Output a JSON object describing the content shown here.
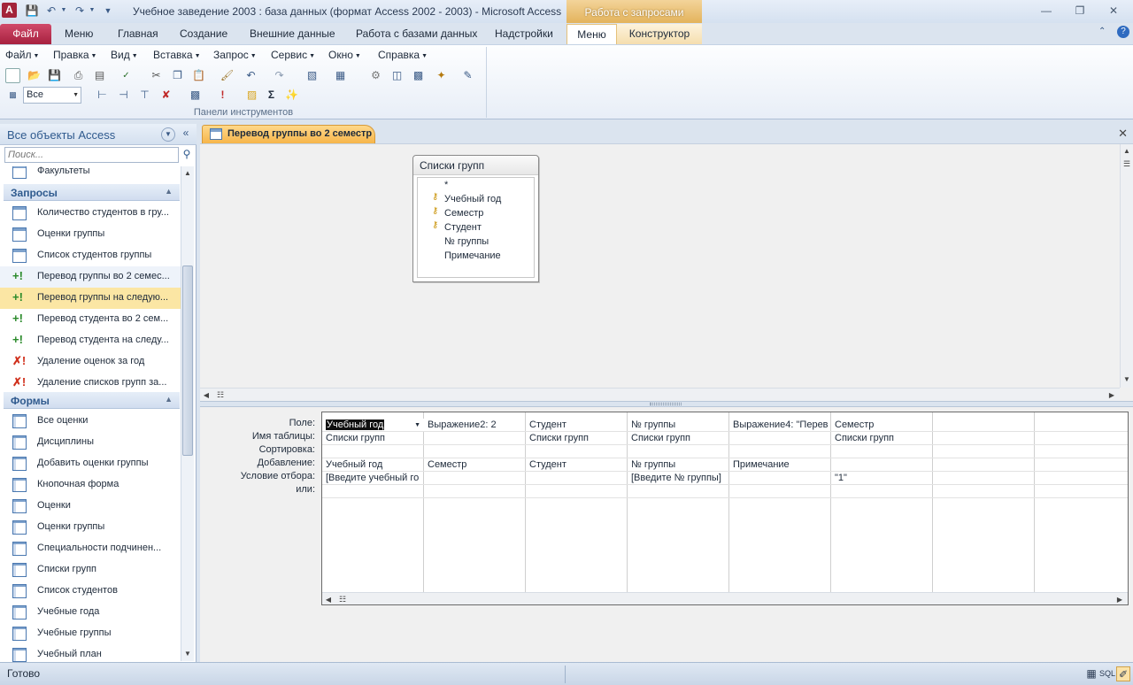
{
  "window": {
    "title": "Учебное заведение 2003 : база данных (формат Access 2002 - 2003)  -  Microsoft Access",
    "app_letter": "A",
    "context_tab_header": "Работа с запросами"
  },
  "ribbon_tabs": {
    "file": "Файл",
    "tabs": [
      "Меню",
      "Главная",
      "Создание",
      "Внешние данные",
      "Работа с базами данных",
      "Надстройки"
    ],
    "active": "Меню",
    "constructor": "Конструктор"
  },
  "menu_bar": [
    "Файл",
    "Правка",
    "Вид",
    "Вставка",
    "Запрос",
    "Сервис",
    "Окно",
    "Справка"
  ],
  "toolbar": {
    "scope_value": "Все",
    "group_label": "Панели инструментов",
    "sigma": "Σ"
  },
  "nav_pane": {
    "title": "Все объекты Access",
    "search_placeholder": "Поиск...",
    "top_item": "Факультеты",
    "groups": [
      {
        "label": "Запросы",
        "items": [
          {
            "label": "Количество студентов в гру...",
            "kind": "select"
          },
          {
            "label": "Оценки группы",
            "kind": "select"
          },
          {
            "label": "Список студентов группы",
            "kind": "select"
          },
          {
            "label": "Перевод группы во 2 семес...",
            "kind": "append",
            "state": "hover"
          },
          {
            "label": "Перевод группы на следую...",
            "kind": "append",
            "state": "selected"
          },
          {
            "label": "Перевод студента во 2 сем...",
            "kind": "append"
          },
          {
            "label": "Перевод студента на следу...",
            "kind": "append"
          },
          {
            "label": "Удаление оценок за год",
            "kind": "delete"
          },
          {
            "label": "Удаление списков групп за...",
            "kind": "delete"
          }
        ]
      },
      {
        "label": "Формы",
        "items": [
          {
            "label": "Все оценки"
          },
          {
            "label": "Дисциплины"
          },
          {
            "label": "Добавить оценки группы"
          },
          {
            "label": "Кнопочная форма"
          },
          {
            "label": "Оценки"
          },
          {
            "label": "Оценки группы"
          },
          {
            "label": "Специальности подчинен..."
          },
          {
            "label": "Списки групп"
          },
          {
            "label": "Список студентов"
          },
          {
            "label": "Учебные года"
          },
          {
            "label": "Учебные группы"
          },
          {
            "label": "Учебный план"
          }
        ]
      }
    ]
  },
  "document": {
    "tab_title": "Перевод группы во 2 семестр",
    "field_list": {
      "title": "Списки групп",
      "fields": [
        {
          "name": "*",
          "key": false
        },
        {
          "name": "Учебный год",
          "key": true
        },
        {
          "name": "Семестр",
          "key": true
        },
        {
          "name": "Студент",
          "key": true
        },
        {
          "name": "№ группы",
          "key": false
        },
        {
          "name": "Примечание",
          "key": false
        }
      ]
    },
    "grid": {
      "row_labels": [
        "Поле:",
        "Имя таблицы:",
        "Сортировка:",
        "Добавление:",
        "Условие отбора:",
        "или:"
      ],
      "columns": [
        {
          "field": "Учебный год",
          "table": "Списки групп",
          "sort": "",
          "append": "Учебный год",
          "criteria": "[Введите учебный го",
          "or": ""
        },
        {
          "field": "Выражение2: 2",
          "table": "",
          "sort": "",
          "append": "Семестр",
          "criteria": "",
          "or": ""
        },
        {
          "field": "Студент",
          "table": "Списки групп",
          "sort": "",
          "append": "Студент",
          "criteria": "",
          "or": ""
        },
        {
          "field": "№ группы",
          "table": "Списки групп",
          "sort": "",
          "append": "№ группы",
          "criteria": "[Введите № группы]",
          "or": ""
        },
        {
          "field": "Выражение4: \"Перев",
          "table": "",
          "sort": "",
          "append": "Примечание",
          "criteria": "",
          "or": ""
        },
        {
          "field": "Семестр",
          "table": "Списки групп",
          "sort": "",
          "append": "",
          "criteria": "\"1\"",
          "or": ""
        },
        {
          "field": "",
          "table": "",
          "sort": "",
          "append": "",
          "criteria": "",
          "or": ""
        },
        {
          "field": "",
          "table": "",
          "sort": "",
          "append": "",
          "criteria": "",
          "or": ""
        }
      ]
    }
  },
  "status_bar": {
    "text": "Готово",
    "sql_label": "SQL"
  }
}
